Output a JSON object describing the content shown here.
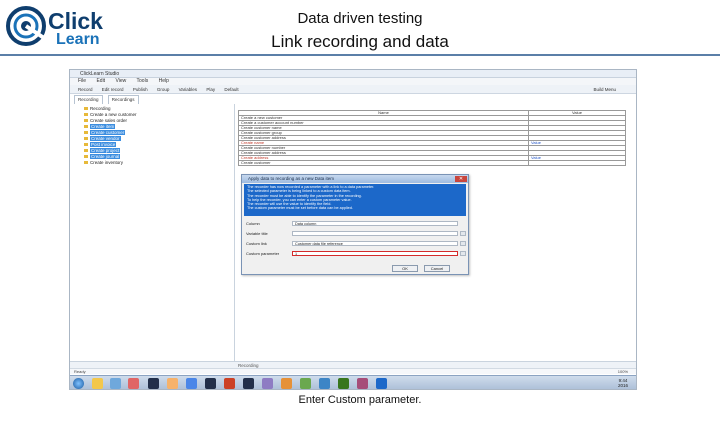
{
  "slide": {
    "logo": {
      "brand_top": "Click",
      "brand_bottom": "Learn"
    },
    "title": "Data driven testing",
    "subtitle": "Link recording and data",
    "caption": "Enter Custom parameter."
  },
  "app": {
    "window_title": "ClickLearn Studio",
    "menu": [
      "File",
      "Edit",
      "View",
      "Tools",
      "Help"
    ],
    "toolbar": [
      "Record",
      "Edit record",
      "Publish",
      "Group",
      "Variables",
      "Play",
      "Default"
    ],
    "toolbar_right": "Build Menu",
    "tabs": [
      "Recording",
      "Recordings"
    ],
    "tree": [
      {
        "label": "Recording",
        "selected": false
      },
      {
        "label": "Create a new customer",
        "selected": false
      },
      {
        "label": "Create sales order",
        "selected": false
      },
      {
        "label": "Create item",
        "selected": true
      },
      {
        "label": "Create customer",
        "selected": true
      },
      {
        "label": "Create vendor",
        "selected": true
      },
      {
        "label": "Post invoice",
        "selected": true
      },
      {
        "label": "Create project",
        "selected": true
      },
      {
        "label": "Create journal",
        "selected": true
      },
      {
        "label": "Create inventory",
        "selected": false
      }
    ],
    "grid": {
      "headers": [
        "Name",
        "Value"
      ],
      "rows": [
        {
          "name": "Create a new customer",
          "value": "",
          "red": false
        },
        {
          "name": "Create a customer account number",
          "value": "",
          "red": false
        },
        {
          "name": "Create customer name",
          "value": "",
          "red": false
        },
        {
          "name": "Create customer group",
          "value": "",
          "red": false
        },
        {
          "name": "Create customer address",
          "value": "",
          "red": false
        },
        {
          "name": "Create name",
          "value": "Value",
          "red": true
        },
        {
          "name": "Create customer number",
          "value": "",
          "red": false
        },
        {
          "name": "Create customer address",
          "value": "",
          "red": false
        },
        {
          "name": "Create address",
          "value": "Value",
          "red": true
        },
        {
          "name": "Create customer",
          "value": "",
          "red": false
        }
      ]
    },
    "status_strip": "Recording",
    "status_bar": "Ready",
    "status_right": "100%",
    "clock": {
      "time": "9:44",
      "date": "2016"
    }
  },
  "dialog": {
    "title": "Apply data to recording as a new Data item",
    "info_lines": [
      "The recorder has now recorded a parameter with a link to a data parameter.",
      "The selected parameter is being linked to a custom data item.",
      "The recorder must be able to identify the parameter in the recording.",
      "To help the recorder, you can enter a custom parameter value.",
      "The recorder will use the value to identify the field.",
      "The custom parameter must be set before data can be applied."
    ],
    "fields": [
      {
        "label": "Column",
        "value": "Data column",
        "has_button": false
      },
      {
        "label": "Variable title",
        "value": "",
        "has_button": true
      },
      {
        "label": "Custom link",
        "value": "Customer data file reference",
        "has_button": true
      },
      {
        "label": "Custom parameter",
        "value": "1",
        "has_button": true,
        "highlight": true
      }
    ],
    "buttons": {
      "ok": "OK",
      "cancel": "Cancel"
    }
  },
  "colors": {
    "title_rule": "#5b7fa8",
    "info_panel": "#1c68c9",
    "highlight": "#d42b2b",
    "selection": "#3c8ee0"
  }
}
